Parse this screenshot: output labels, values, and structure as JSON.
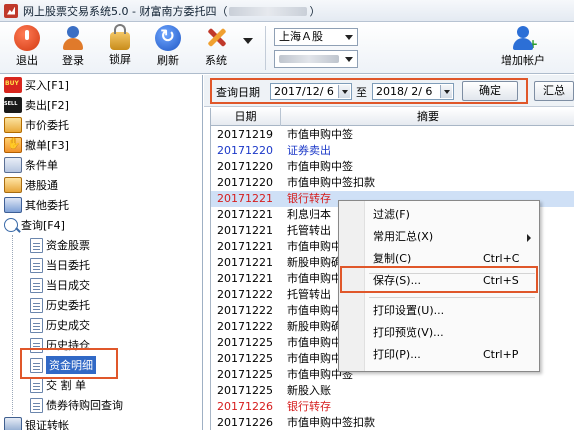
{
  "window": {
    "title_prefix": "网上股票交易系统5.0 - 财富南方委托四（",
    "title_suffix": "）"
  },
  "toolbar": {
    "buttons": [
      {
        "label": "退出",
        "icon": "power-icon"
      },
      {
        "label": "登录",
        "icon": "user-login-icon"
      },
      {
        "label": "锁屏",
        "icon": "lock-icon"
      },
      {
        "label": "刷新",
        "icon": "refresh-icon"
      },
      {
        "label": "系统",
        "icon": "tools-icon"
      }
    ],
    "market": "上海Ａ股",
    "add_account": "增加帐户"
  },
  "tree": {
    "items": [
      {
        "label": "买入[F1]",
        "icon": "buy-icon"
      },
      {
        "label": "卖出[F2]",
        "icon": "sell-icon"
      },
      {
        "label": "市价委托",
        "icon": "market-order-icon"
      },
      {
        "label": "撤单[F3]",
        "icon": "cancel-order-icon"
      },
      {
        "label": "条件单",
        "icon": "conditional-order-icon"
      },
      {
        "label": "港股通",
        "icon": "hk-connect-icon"
      },
      {
        "label": "其他委托",
        "icon": "other-order-icon"
      },
      {
        "label": "查询[F4]",
        "icon": "query-icon"
      }
    ],
    "query_children": [
      {
        "label": "资金股票"
      },
      {
        "label": "当日委托"
      },
      {
        "label": "当日成交"
      },
      {
        "label": "历史委托"
      },
      {
        "label": "历史成交"
      },
      {
        "label": "历史持仓"
      },
      {
        "label": "资金明细",
        "selected": true
      },
      {
        "label": "交 割 单"
      },
      {
        "label": "债券待购回查询"
      }
    ],
    "last_item": {
      "label": "银证转帐",
      "icon": "bank-transfer-icon"
    }
  },
  "query": {
    "label": "查询日期",
    "start_date": "2017/12/ 6",
    "to": "至",
    "end_date": "2018/ 2/ 6",
    "confirm": "确定",
    "summary": "汇总"
  },
  "grid": {
    "headers": [
      "日期",
      "摘要"
    ],
    "rows": [
      {
        "date": "20171219",
        "desc": "市值申购中签",
        "color": "black"
      },
      {
        "date": "20171220",
        "desc": "证券卖出",
        "color": "blue"
      },
      {
        "date": "20171220",
        "desc": "市值申购中签",
        "color": "black"
      },
      {
        "date": "20171220",
        "desc": "市值申购中签扣款",
        "color": "black"
      },
      {
        "date": "20171221",
        "desc": "银行转存",
        "color": "red",
        "selected": true
      },
      {
        "date": "20171221",
        "desc": "利息归本",
        "color": "black"
      },
      {
        "date": "20171221",
        "desc": "托管转出",
        "color": "black"
      },
      {
        "date": "20171221",
        "desc": "市值申购中签",
        "color": "black"
      },
      {
        "date": "20171221",
        "desc": "新股申购确认",
        "color": "black"
      },
      {
        "date": "20171221",
        "desc": "市值申购中签",
        "color": "black"
      },
      {
        "date": "20171222",
        "desc": "托管转出",
        "color": "black"
      },
      {
        "date": "20171222",
        "desc": "市值申购中签",
        "color": "black"
      },
      {
        "date": "20171222",
        "desc": "新股申购确认",
        "color": "black"
      },
      {
        "date": "20171225",
        "desc": "市值申购中签",
        "color": "black"
      },
      {
        "date": "20171225",
        "desc": "市值申购中签",
        "color": "black"
      },
      {
        "date": "20171225",
        "desc": "市值申购中签",
        "color": "black"
      },
      {
        "date": "20171225",
        "desc": "新股入账",
        "color": "black"
      },
      {
        "date": "20171226",
        "desc": "银行转存",
        "color": "red"
      },
      {
        "date": "20171226",
        "desc": "市值申购中签扣款",
        "color": "black"
      }
    ]
  },
  "context_menu": {
    "items": [
      {
        "label": "过滤(F)",
        "shortcut": ""
      },
      {
        "label": "常用汇总(X)",
        "shortcut": "",
        "submenu": true
      },
      {
        "label": "复制(C)",
        "shortcut": "Ctrl+C"
      },
      {
        "label": "保存(S)...",
        "shortcut": "Ctrl+S",
        "highlighted": true
      },
      {
        "label": "打印设置(U)...",
        "shortcut": ""
      },
      {
        "label": "打印预览(V)...",
        "shortcut": ""
      },
      {
        "label": "打印(P)...",
        "shortcut": "Ctrl+P"
      }
    ]
  },
  "colors": {
    "highlight_border": "#e0572a",
    "selection": "#3169c6",
    "blue_text": "#1b38c8",
    "red_text": "#d61d1d"
  }
}
